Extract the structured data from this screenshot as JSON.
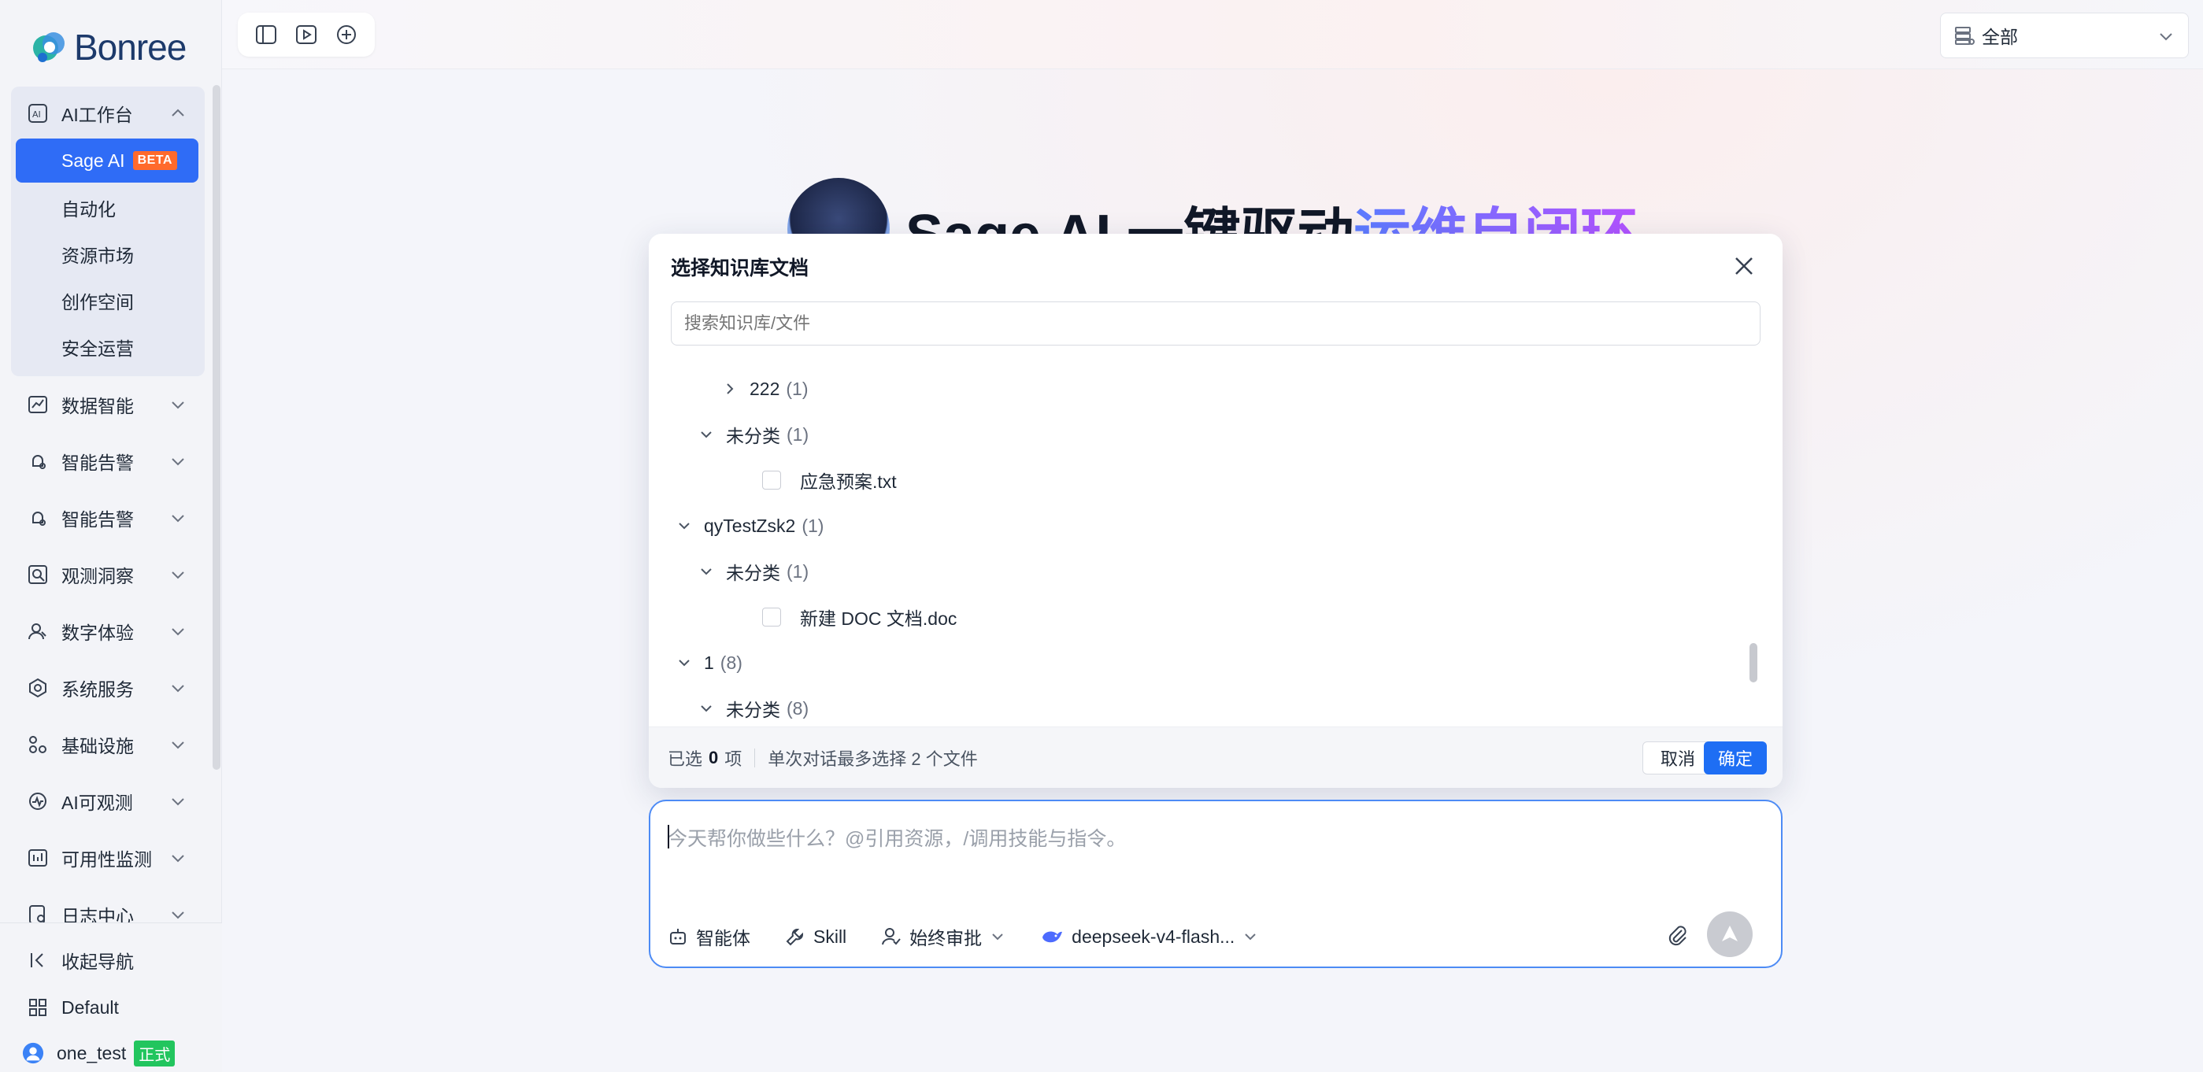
{
  "sidebar": {
    "brand": "Bonree",
    "groups": [
      {
        "label": "AI工作台"
      },
      {
        "label": "数据智能"
      },
      {
        "label": "智能告警"
      },
      {
        "label": "智能告警"
      },
      {
        "label": "观测洞察"
      },
      {
        "label": "数字体验"
      },
      {
        "label": "系统服务"
      },
      {
        "label": "基础设施"
      },
      {
        "label": "AI可观测"
      },
      {
        "label": "可用性监测"
      },
      {
        "label": "日志中心"
      }
    ],
    "sub_items": [
      {
        "label": "Sage AI",
        "badge": "BETA"
      },
      {
        "label": "自动化"
      },
      {
        "label": "资源市场"
      },
      {
        "label": "创作空间"
      },
      {
        "label": "安全运营"
      }
    ],
    "bottom": {
      "collapse": "收起导航",
      "workspace": "Default",
      "user": "one_test",
      "user_tag": "正式"
    }
  },
  "topbar": {
    "scope_value": "全部"
  },
  "hero": {
    "prefix": "Sage AI",
    "mid": "一键驱动",
    "highlight": "运维自闭环"
  },
  "modal": {
    "title": "选择知识库文档",
    "search_placeholder": "搜索知识库/文件",
    "tree": [
      {
        "label": "222",
        "count": "(1)"
      },
      {
        "label": "未分类",
        "count": "(1)"
      },
      {
        "label": "应急预案.txt"
      },
      {
        "label": "qyTestZsk2",
        "count": "(1)"
      },
      {
        "label": "未分类",
        "count": "(1)"
      },
      {
        "label": "新建 DOC 文档.doc"
      },
      {
        "label": "1",
        "count": "(8)"
      },
      {
        "label": "未分类",
        "count": "(8)"
      }
    ],
    "footer": {
      "selected_prefix": "已选",
      "selected_count": "0",
      "selected_suffix": "项",
      "hint": "单次对话最多选择 2 个文件",
      "cancel": "取消",
      "confirm": "确定"
    }
  },
  "chat": {
    "placeholder": "今天帮你做些什么？@引用资源，/调用技能与指令。",
    "agent": "智能体",
    "skill": "Skill",
    "approval": "始终审批",
    "model": "deepseek-v4-flash..."
  },
  "colors": {
    "accent": "#2f6cf6",
    "beta": "#ff6a2c",
    "tag": "#22c55e"
  }
}
